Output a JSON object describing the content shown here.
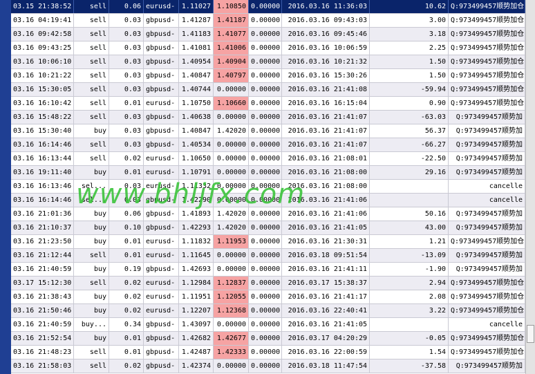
{
  "watermark": "www.bhljfx.com",
  "rows": [
    {
      "open_time": "03.15 21:38:52",
      "type": "sell",
      "lots": "0.06",
      "symbol": "eurusd-",
      "open_price": "1.11027",
      "sl": "1.10850",
      "tp": "0.00000",
      "close_time": "2016.03.16 11:36:03",
      "profit": "10.62",
      "comment": "Q:973499457顺势加仓",
      "state": "selected",
      "sl_hl": true
    },
    {
      "open_time": "03.16 04:19:41",
      "type": "sell",
      "lots": "0.03",
      "symbol": "gbpusd-",
      "open_price": "1.41287",
      "sl": "1.41187",
      "tp": "0.00000",
      "close_time": "2016.03.16 09:43:03",
      "profit": "3.00",
      "comment": "Q:973499457顺势加仓.",
      "state": "",
      "sl_hl": true
    },
    {
      "open_time": "03.16 09:42:58",
      "type": "sell",
      "lots": "0.03",
      "symbol": "gbpusd-",
      "open_price": "1.41183",
      "sl": "1.41077",
      "tp": "0.00000",
      "close_time": "2016.03.16 09:45:46",
      "profit": "3.18",
      "comment": "Q:973499457顺势加仓.",
      "state": "alt",
      "sl_hl": true
    },
    {
      "open_time": "03.16 09:43:25",
      "type": "sell",
      "lots": "0.03",
      "symbol": "gbpusd-",
      "open_price": "1.41081",
      "sl": "1.41006",
      "tp": "0.00000",
      "close_time": "2016.03.16 10:06:59",
      "profit": "2.25",
      "comment": "Q:973499457顺势加仓.",
      "state": "",
      "sl_hl": true
    },
    {
      "open_time": "03.16 10:06:10",
      "type": "sell",
      "lots": "0.03",
      "symbol": "gbpusd-",
      "open_price": "1.40954",
      "sl": "1.40904",
      "tp": "0.00000",
      "close_time": "2016.03.16 10:21:32",
      "profit": "1.50",
      "comment": "Q:973499457顺势加仓.",
      "state": "alt",
      "sl_hl": true
    },
    {
      "open_time": "03.16 10:21:22",
      "type": "sell",
      "lots": "0.03",
      "symbol": "gbpusd-",
      "open_price": "1.40847",
      "sl": "1.40797",
      "tp": "0.00000",
      "close_time": "2016.03.16 15:30:26",
      "profit": "1.50",
      "comment": "Q:973499457顺势加仓.",
      "state": "",
      "sl_hl": true
    },
    {
      "open_time": "03.16 15:30:05",
      "type": "sell",
      "lots": "0.03",
      "symbol": "gbpusd-",
      "open_price": "1.40744",
      "sl": "0.00000",
      "tp": "0.00000",
      "close_time": "2016.03.16 21:41:08",
      "profit": "-59.94",
      "comment": "Q:973499457顺势加仓",
      "state": "alt",
      "sl_hl": false
    },
    {
      "open_time": "03.16 16:10:42",
      "type": "sell",
      "lots": "0.01",
      "symbol": "eurusd-",
      "open_price": "1.10750",
      "sl": "1.10660",
      "tp": "0.00000",
      "close_time": "2016.03.16 16:15:04",
      "profit": "0.90",
      "comment": "Q:973499457顺势加仓.",
      "state": "",
      "sl_hl": true
    },
    {
      "open_time": "03.16 15:48:22",
      "type": "sell",
      "lots": "0.03",
      "symbol": "gbpusd-",
      "open_price": "1.40638",
      "sl": "0.00000",
      "tp": "0.00000",
      "close_time": "2016.03.16 21:41:07",
      "profit": "-63.03",
      "comment": "Q:973499457顺势加",
      "state": "alt",
      "sl_hl": false
    },
    {
      "open_time": "03.16 15:30:40",
      "type": "buy",
      "lots": "0.03",
      "symbol": "gbpusd-",
      "open_price": "1.40847",
      "sl": "1.42020",
      "tp": "0.00000",
      "close_time": "2016.03.16 21:41:07",
      "profit": "56.37",
      "comment": "Q:973499457顺势加",
      "state": "",
      "sl_hl": false
    },
    {
      "open_time": "03.16 16:14:46",
      "type": "sell",
      "lots": "0.03",
      "symbol": "gbpusd-",
      "open_price": "1.40534",
      "sl": "0.00000",
      "tp": "0.00000",
      "close_time": "2016.03.16 21:41:07",
      "profit": "-66.27",
      "comment": "Q:973499457顺势加",
      "state": "alt",
      "sl_hl": false
    },
    {
      "open_time": "03.16 16:13:44",
      "type": "sell",
      "lots": "0.02",
      "symbol": "eurusd-",
      "open_price": "1.10650",
      "sl": "0.00000",
      "tp": "0.00000",
      "close_time": "2016.03.16 21:08:01",
      "profit": "-22.50",
      "comment": "Q:973499457顺势加",
      "state": "",
      "sl_hl": false
    },
    {
      "open_time": "03.16 19:11:40",
      "type": "buy",
      "lots": "0.01",
      "symbol": "eurusd-",
      "open_price": "1.10791",
      "sl": "0.00000",
      "tp": "0.00000",
      "close_time": "2016.03.16 21:08:00",
      "profit": "29.16",
      "comment": "Q:973499457顺势加",
      "state": "alt",
      "sl_hl": false
    },
    {
      "open_time": "03.16 16:13:46",
      "type": "sel...",
      "lots": "0.03",
      "symbol": "eurusd-",
      "open_price": "1.11332",
      "sl": "0.00000",
      "tp": "0.00000",
      "close_time": "2016.03.16 21:08:00",
      "profit": "",
      "comment": "cancelle",
      "state": "",
      "sl_hl": false
    },
    {
      "open_time": "03.16 16:14:46",
      "type": "sel...",
      "lots": "0.03",
      "symbol": "gbpusd-",
      "open_price": "1.42290",
      "sl": "0.00000",
      "tp": "0.00000",
      "close_time": "2016.03.16 21:41:06",
      "profit": "",
      "comment": "cancelle",
      "state": "alt",
      "sl_hl": false
    },
    {
      "open_time": "03.16 21:01:36",
      "type": "buy",
      "lots": "0.06",
      "symbol": "gbpusd-",
      "open_price": "1.41893",
      "sl": "1.42020",
      "tp": "0.00000",
      "close_time": "2016.03.16 21:41:06",
      "profit": "50.16",
      "comment": "Q:973499457顺势加",
      "state": "",
      "sl_hl": false
    },
    {
      "open_time": "03.16 21:10:37",
      "type": "buy",
      "lots": "0.10",
      "symbol": "gbpusd-",
      "open_price": "1.42293",
      "sl": "1.42020",
      "tp": "0.00000",
      "close_time": "2016.03.16 21:41:05",
      "profit": "43.00",
      "comment": "Q:973499457顺势加",
      "state": "alt",
      "sl_hl": false
    },
    {
      "open_time": "03.16 21:23:50",
      "type": "buy",
      "lots": "0.01",
      "symbol": "eurusd-",
      "open_price": "1.11832",
      "sl": "1.11953",
      "tp": "0.00000",
      "close_time": "2016.03.16 21:30:31",
      "profit": "1.21",
      "comment": "Q:973499457顺势加仓.",
      "state": "",
      "sl_hl": true
    },
    {
      "open_time": "03.16 21:12:44",
      "type": "sell",
      "lots": "0.01",
      "symbol": "eurusd-",
      "open_price": "1.11645",
      "sl": "0.00000",
      "tp": "0.00000",
      "close_time": "2016.03.18 09:51:54",
      "profit": "-13.09",
      "comment": "Q:973499457顺势加",
      "state": "alt",
      "sl_hl": false
    },
    {
      "open_time": "03.16 21:40:59",
      "type": "buy",
      "lots": "0.19",
      "symbol": "gbpusd-",
      "open_price": "1.42693",
      "sl": "0.00000",
      "tp": "0.00000",
      "close_time": "2016.03.16 21:41:11",
      "profit": "-1.90",
      "comment": "Q:973499457顺势加",
      "state": "",
      "sl_hl": false
    },
    {
      "open_time": "03.17 15:12:30",
      "type": "sell",
      "lots": "0.02",
      "symbol": "eurusd-",
      "open_price": "1.12984",
      "sl": "1.12837",
      "tp": "0.00000",
      "close_time": "2016.03.17 15:38:37",
      "profit": "2.94",
      "comment": "Q:973499457顺势加仓.",
      "state": "alt",
      "sl_hl": true
    },
    {
      "open_time": "03.16 21:38:43",
      "type": "buy",
      "lots": "0.02",
      "symbol": "eurusd-",
      "open_price": "1.11951",
      "sl": "1.12055",
      "tp": "0.00000",
      "close_time": "2016.03.16 21:41:17",
      "profit": "2.08",
      "comment": "Q:973499457顺势加仓.",
      "state": "",
      "sl_hl": true
    },
    {
      "open_time": "03.16 21:50:46",
      "type": "buy",
      "lots": "0.02",
      "symbol": "eurusd-",
      "open_price": "1.12207",
      "sl": "1.12368",
      "tp": "0.00000",
      "close_time": "2016.03.16 22:40:41",
      "profit": "3.22",
      "comment": "Q:973499457顺势加仓.",
      "state": "alt",
      "sl_hl": true
    },
    {
      "open_time": "03.16 21:40:59",
      "type": "buy...",
      "lots": "0.34",
      "symbol": "gbpusd-",
      "open_price": "1.43097",
      "sl": "0.00000",
      "tp": "0.00000",
      "close_time": "2016.03.16 21:41:05",
      "profit": "",
      "comment": "cancelle",
      "state": "",
      "sl_hl": false
    },
    {
      "open_time": "03.16 21:52:54",
      "type": "buy",
      "lots": "0.01",
      "symbol": "gbpusd-",
      "open_price": "1.42682",
      "sl": "1.42677",
      "tp": "0.00000",
      "close_time": "2016.03.17 04:20:29",
      "profit": "-0.05",
      "comment": "Q:973499457顺势加仓.",
      "state": "alt",
      "sl_hl": true
    },
    {
      "open_time": "03.16 21:48:23",
      "type": "sell",
      "lots": "0.01",
      "symbol": "gbpusd-",
      "open_price": "1.42487",
      "sl": "1.42333",
      "tp": "0.00000",
      "close_time": "2016.03.16 22:00:59",
      "profit": "1.54",
      "comment": "Q:973499457顺势加仓.",
      "state": "",
      "sl_hl": true
    },
    {
      "open_time": "03.16 21:58:03",
      "type": "sell",
      "lots": "0.02",
      "symbol": "gbpusd-",
      "open_price": "1.42374",
      "sl": "0.00000",
      "tp": "0.00000",
      "close_time": "2016.03.18 11:47:54",
      "profit": "-37.58",
      "comment": "Q:973499457顺势加",
      "state": "alt",
      "sl_hl": false
    }
  ]
}
